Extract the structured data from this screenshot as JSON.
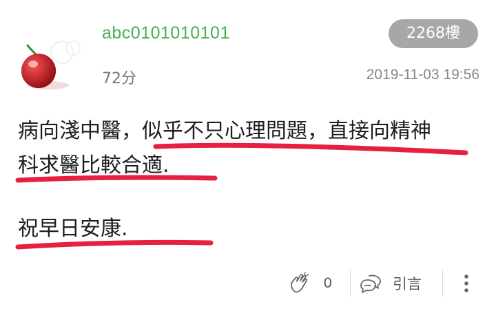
{
  "post": {
    "username": "abc0101010101",
    "floor": "2268樓",
    "score": "72分",
    "timestamp": "2019-11-03 19:56",
    "content_lines": [
      "病向淺中醫，似乎不只心理問題，直接向精神",
      "科求醫比較合適.",
      "祝早日安康."
    ],
    "avatar_icon": "cherry-avatar-icon"
  },
  "footer": {
    "like_icon": "clap-icon",
    "like_count": "0",
    "quote_icon": "quote-bubble-icon",
    "quote_label": "引言",
    "more_icon": "more-vertical-icon"
  },
  "colors": {
    "username": "#4caf50",
    "badge": "#a7a7a7",
    "highlight_stroke": "#e8203f",
    "meta_text": "#888888"
  }
}
